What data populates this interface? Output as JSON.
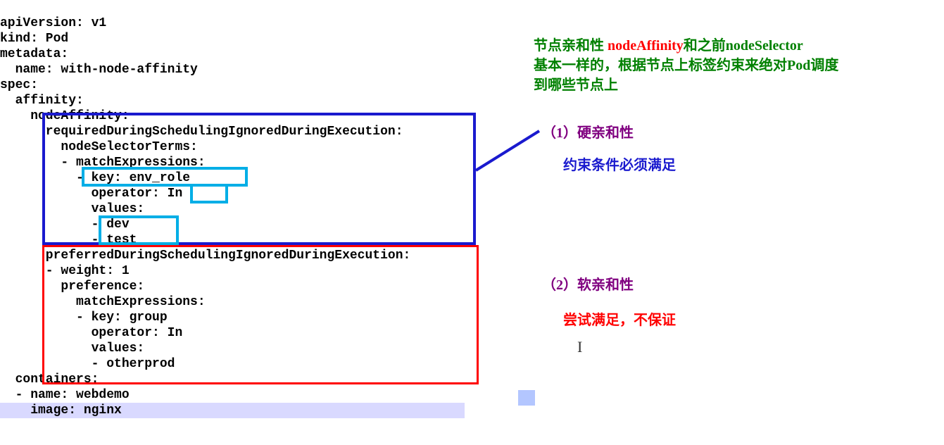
{
  "code": {
    "lines": [
      "apiVersion: v1",
      "kind: Pod",
      "metadata:",
      "  name: with-node-affinity",
      "spec:",
      "  affinity:",
      "    nodeAffinity:",
      "      requiredDuringSchedulingIgnoredDuringExecution:",
      "        nodeSelectorTerms:",
      "        - matchExpressions:",
      "          - key: env_role",
      "            operator: In",
      "            values:",
      "            - dev",
      "            - test",
      "      preferredDuringSchedulingIgnoredDuringExecution:",
      "      - weight: 1",
      "        preference:",
      "          matchExpressions:",
      "          - key: group",
      "            operator: In",
      "            values:",
      "            - otherprod",
      "  containers:",
      "  - name: webdemo",
      "    image: nginx"
    ],
    "highlighted_last": "    image: nginx"
  },
  "annotations": {
    "intro_line1_a": "节点亲和性 ",
    "intro_line1_b": "nodeAffinity",
    "intro_line1_c": "和之前nodeSelector",
    "intro_line2": "基本一样的，根据节点上标签约束来绝对Pod调度",
    "intro_line3": "到哪些节点上",
    "hard_title": "（1）硬亲和性",
    "hard_desc": "约束条件必须满足",
    "soft_title": "（2）软亲和性",
    "soft_desc": "尝试满足，不保证"
  }
}
